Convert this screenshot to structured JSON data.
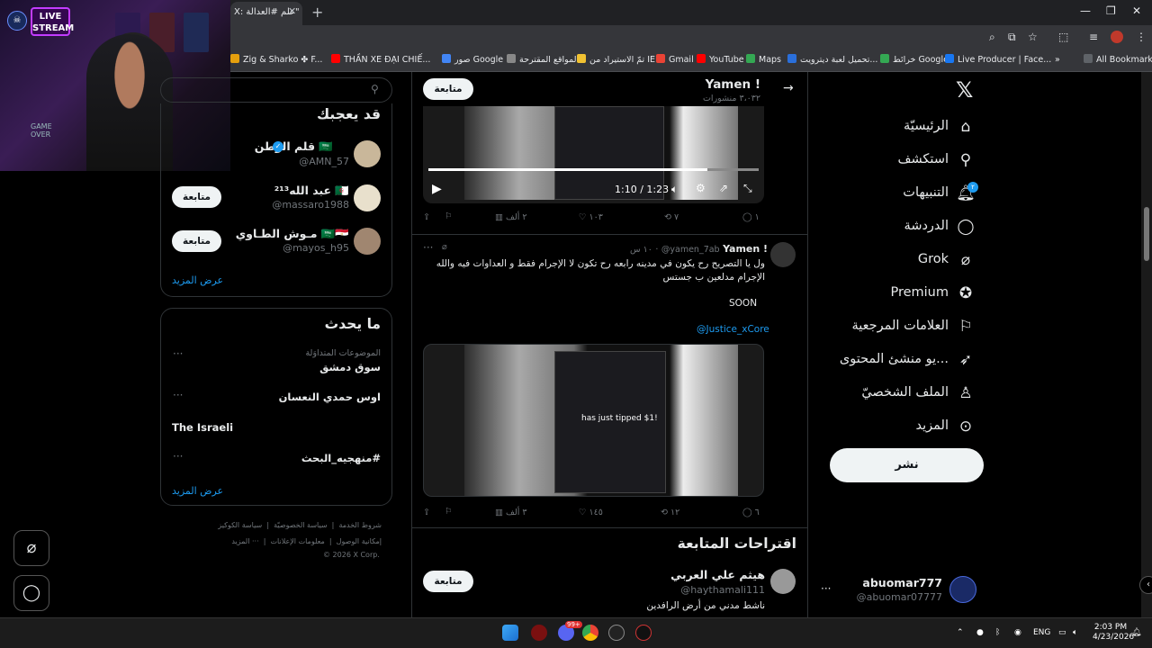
{
  "browser": {
    "tab_title": "X :علم العدالة#\" \"",
    "tab_title_short": "X: علم #العدالة\"",
    "new_tab": "+",
    "bookmarks": [
      {
        "label": "Zig & Sharko ✤ F...",
        "color": "#e5a00d"
      },
      {
        "label": "THẦN XE ĐẠI CHIẾ...",
        "color": "#ff0000"
      },
      {
        "label": "صور Google",
        "color": "#4285f4"
      },
      {
        "label": "المواقع المقترحة",
        "color": "#888888"
      },
      {
        "label": "تمّ الاستيراد من IE",
        "color": "#f1c232"
      },
      {
        "label": "Gmail",
        "color": "#ea4335"
      },
      {
        "label": "YouTube",
        "color": "#ff0000"
      },
      {
        "label": "Maps",
        "color": "#34a853"
      },
      {
        "label": "تحميل لعبة ديترويت...",
        "color": "#2a6fdb"
      },
      {
        "label": "خرائط Google",
        "color": "#34a853"
      },
      {
        "label": "Live Producer | Face...",
        "color": "#1877f2"
      }
    ],
    "all_bookmarks": "All Bookmarks",
    "bookmarks_more": "»"
  },
  "stream": {
    "live_label_1": "LIVE",
    "live_label_2": "STREAM",
    "game_over_1": "GAME",
    "game_over_2": "OVER"
  },
  "right_rail": {
    "search_placeholder": "",
    "who_to_follow_title": "قد يعجبك",
    "suggestions": [
      {
        "name": "قلم الوطن 🇸🇦",
        "handle": "@AMN_57",
        "verified": true,
        "follow": ""
      },
      {
        "name": "عبد الله²¹³ 🇩🇿",
        "handle": "@massaro1988",
        "verified": false,
        "follow": "متابعة"
      },
      {
        "name": "مـوش الطـاوي 🇸🇦🇪🇬",
        "handle": "@mayos_h95",
        "verified": false,
        "follow": "متابعة"
      }
    ],
    "show_more": "عرض المزيد",
    "trends_title": "ما يحدث",
    "trends": [
      {
        "meta": "الموضوعات المتداوَلة",
        "name": "سوق دمشق"
      },
      {
        "meta": "",
        "name": "اوس حمدي النعسان"
      },
      {
        "meta": "",
        "name": "The Israeli"
      },
      {
        "meta": "",
        "name": "#منهجيه_البحث"
      }
    ],
    "trends_show_more": "عرض المزيد",
    "footer_line1": [
      "شروط الخدمة",
      "سياسة الخصوصيّة",
      "سياسة الكوكيز"
    ],
    "footer_line2": [
      "إمكانية الوصول",
      "معلومات الإعلانات",
      "··· المزيد"
    ],
    "copyright": "© 2026 X Corp."
  },
  "timeline": {
    "header_name": "Yamen !",
    "header_sub": "٣،٠٣٢ منشورات",
    "header_follow": "متابعة",
    "post1": {
      "time_current": "1:10",
      "time_total": "1:23",
      "replies": "١",
      "reposts": "٧",
      "likes": "١٠٣",
      "views": "٢ ألف"
    },
    "post2": {
      "author": "Yamen !",
      "handle": "@yamen_7ab",
      "time": "١٠ س",
      "text_line1": "ول يا التصريح رح يكون في مدينه رابعه رح تكون لا الإجرام فقط و العداوات فيه والله",
      "text_line2": "الإجرام مدلعين ب جستس",
      "soon": "SOON",
      "mention": "@Justice_xCore",
      "tip_text": "has just tipped $1!",
      "replies": "٦",
      "reposts": "١٢",
      "likes": "١٤٥",
      "views": "٣ ألف"
    },
    "follow_suggestions_title": "اقتراحات المتابعة",
    "suggest": {
      "name": "هيثم علي العربي",
      "handle": "@haythamali111",
      "bio": "ناشط مدني من أرض الرافدين",
      "follow": "متابعة"
    }
  },
  "nav": {
    "items": [
      {
        "label": "الرئيسيّة",
        "icon": "home-icon"
      },
      {
        "label": "استكشف",
        "icon": "search-icon"
      },
      {
        "label": "التنبيهات",
        "icon": "bell-icon"
      },
      {
        "label": "الدردشة",
        "icon": "chat-icon"
      },
      {
        "label": "Grok",
        "icon": "grok-icon"
      },
      {
        "label": "Premium",
        "icon": "premium-icon"
      },
      {
        "label": "العلامات المرجعية",
        "icon": "bookmark-icon"
      },
      {
        "label": "...يو منشئ المحتوى",
        "icon": "rocket-icon"
      },
      {
        "label": "الملف الشخصيّ",
        "icon": "profile-icon"
      },
      {
        "label": "المزيد",
        "icon": "more-icon"
      }
    ],
    "notif_count": "٢",
    "post_button": "نشر",
    "account_name": "abuomar777",
    "account_handle": "@abuomar07777"
  },
  "taskbar": {
    "lang": "ENG",
    "time": "2:03 PM",
    "date": "4/23/2026",
    "discord_badge": "99+"
  }
}
